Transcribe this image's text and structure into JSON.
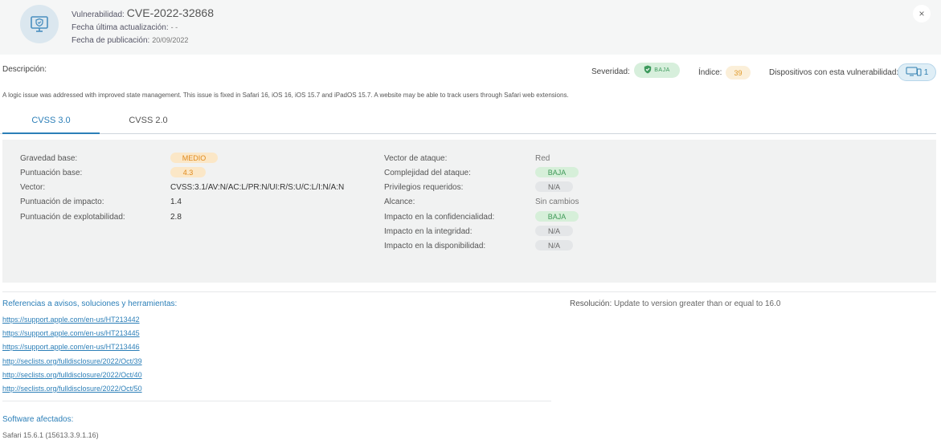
{
  "header": {
    "vuln_label": "Vulnerabilidad:",
    "vuln_id": "CVE-2022-32868",
    "updated_label": "Fecha última actualización:",
    "updated_value": "- -",
    "published_label": "Fecha de publicación:",
    "published_value": "20/09/2022",
    "close": "×"
  },
  "summary": {
    "description_label": "Descripción:",
    "severity_label": "Severidad:",
    "severity_value": "BAJA",
    "index_label": "Índice:",
    "index_value": "39",
    "devices_label": "Dispositivos con esta vulnerabilidad:",
    "devices_count": "1",
    "description_text": "A logic issue was addressed with improved state management. This issue is fixed in Safari 16, iOS 16, iOS 15.7 and iPadOS 15.7. A website may be able to track users through Safari web extensions."
  },
  "tabs": [
    "CVSS 3.0",
    "CVSS 2.0"
  ],
  "cvss": {
    "left": [
      {
        "label": "Gravedad base:",
        "value": "MEDIO"
      },
      {
        "label": "Puntuación base:",
        "value": "4.3"
      },
      {
        "label": "Vector:",
        "value": "CVSS:3.1/AV:N/AC:L/PR:N/UI:R/S:U/C:L/I:N/A:N"
      },
      {
        "label": "Puntuación de impacto:",
        "value": "1.4"
      },
      {
        "label": "Puntuación de explotabilidad:",
        "value": "2.8"
      }
    ],
    "right": [
      {
        "label": "Vector de ataque:",
        "value": "Red"
      },
      {
        "label": "Complejidad del ataque:",
        "value": "BAJA"
      },
      {
        "label": "Privilegios requeridos:",
        "value": "N/A"
      },
      {
        "label": "Alcance:",
        "value": "Sin cambios"
      },
      {
        "label": "Impacto en la confidencialidad:",
        "value": "BAJA"
      },
      {
        "label": "Impacto en la integridad:",
        "value": "N/A"
      },
      {
        "label": "Impacto en la disponibilidad:",
        "value": "N/A"
      }
    ]
  },
  "references": {
    "title": "Referencias a avisos, soluciones y herramientas:",
    "links": [
      "https://support.apple.com/en-us/HT213442",
      "https://support.apple.com/en-us/HT213445",
      "https://support.apple.com/en-us/HT213446",
      "http://seclists.org/fulldisclosure/2022/Oct/39",
      "http://seclists.org/fulldisclosure/2022/Oct/40",
      "http://seclists.org/fulldisclosure/2022/Oct/50"
    ]
  },
  "resolution": {
    "label": "Resolución:",
    "value": "Update to version greater than or equal to 16.0"
  },
  "software": {
    "title": "Software afectados:",
    "items": [
      "Safari 15.6.1 (15613.3.9.1.16)"
    ]
  },
  "colors": {
    "accent": "#2c7fb8",
    "low_green": "#3e9857",
    "medium_orange": "#e08a1c"
  }
}
